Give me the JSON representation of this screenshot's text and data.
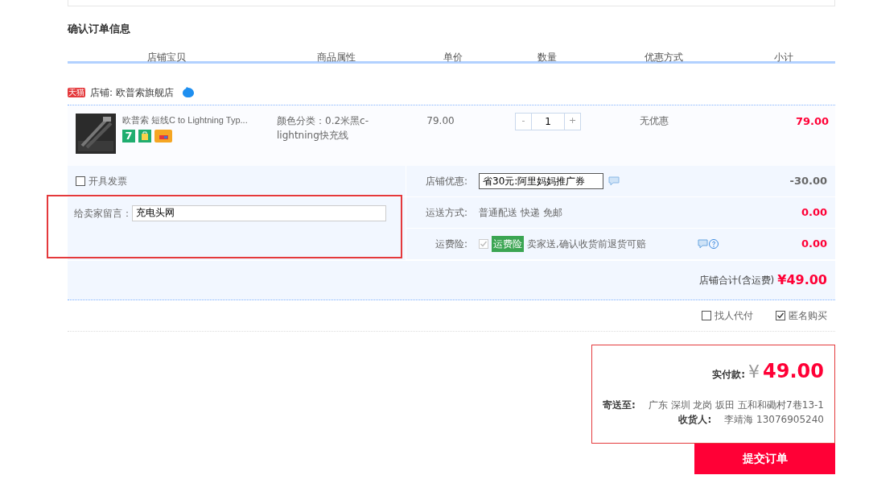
{
  "section_title": "确认订单信息",
  "columns": [
    "店铺宝贝",
    "商品属性",
    "单价",
    "数量",
    "优惠方式",
    "小计"
  ],
  "shop": {
    "badge": "天猫",
    "label": "店铺: 欧普索旗舰店"
  },
  "items": [
    {
      "title": "欧普索 短线C to Lightning Typ...",
      "badges": [
        {
          "kind": "seven",
          "text": "7"
        },
        {
          "kind": "bag"
        },
        {
          "kind": "card"
        }
      ],
      "attribute": "颜色分类：0.2米黑c-lightning快充线",
      "price": "79.00",
      "decrement": "-",
      "quantity": "1",
      "increment": "+",
      "discount": "无优惠",
      "subtotal": "79.00"
    }
  ],
  "invoice": {
    "label": "开具发票",
    "checked": false
  },
  "message": {
    "label": "给卖家留言：",
    "value": "充电头网",
    "highlighted": true
  },
  "options": [
    {
      "kind": "select",
      "label": "店铺优惠:",
      "value": "省30元:阿里妈妈推广券",
      "amount": "-30.00"
    },
    {
      "kind": "text",
      "label": "运送方式:",
      "value": "普通配送 快递 免邮",
      "amount": "0.00"
    },
    {
      "kind": "insurance",
      "label": "运费险:",
      "checked": true,
      "tag": "运费险",
      "value": "卖家送,确认收货前退货可赔",
      "amount": "0.00"
    }
  ],
  "shop_total": {
    "label": "店铺合计(含运费)",
    "amount": "¥49.00"
  },
  "extras": [
    {
      "label": "找人代付",
      "checked": false
    },
    {
      "label": "匿名购买",
      "checked": true
    }
  ],
  "summary": {
    "paid_label": "实付款:",
    "currency": "¥",
    "paid_amount": "49.00",
    "address_label": "寄送至:",
    "address": "广东 深圳 龙岗 坂田 五和和磡村7巷13-1",
    "receiver_label": "收货人:",
    "receiver": "李靖海 13076905240"
  },
  "submit": "提交订单"
}
